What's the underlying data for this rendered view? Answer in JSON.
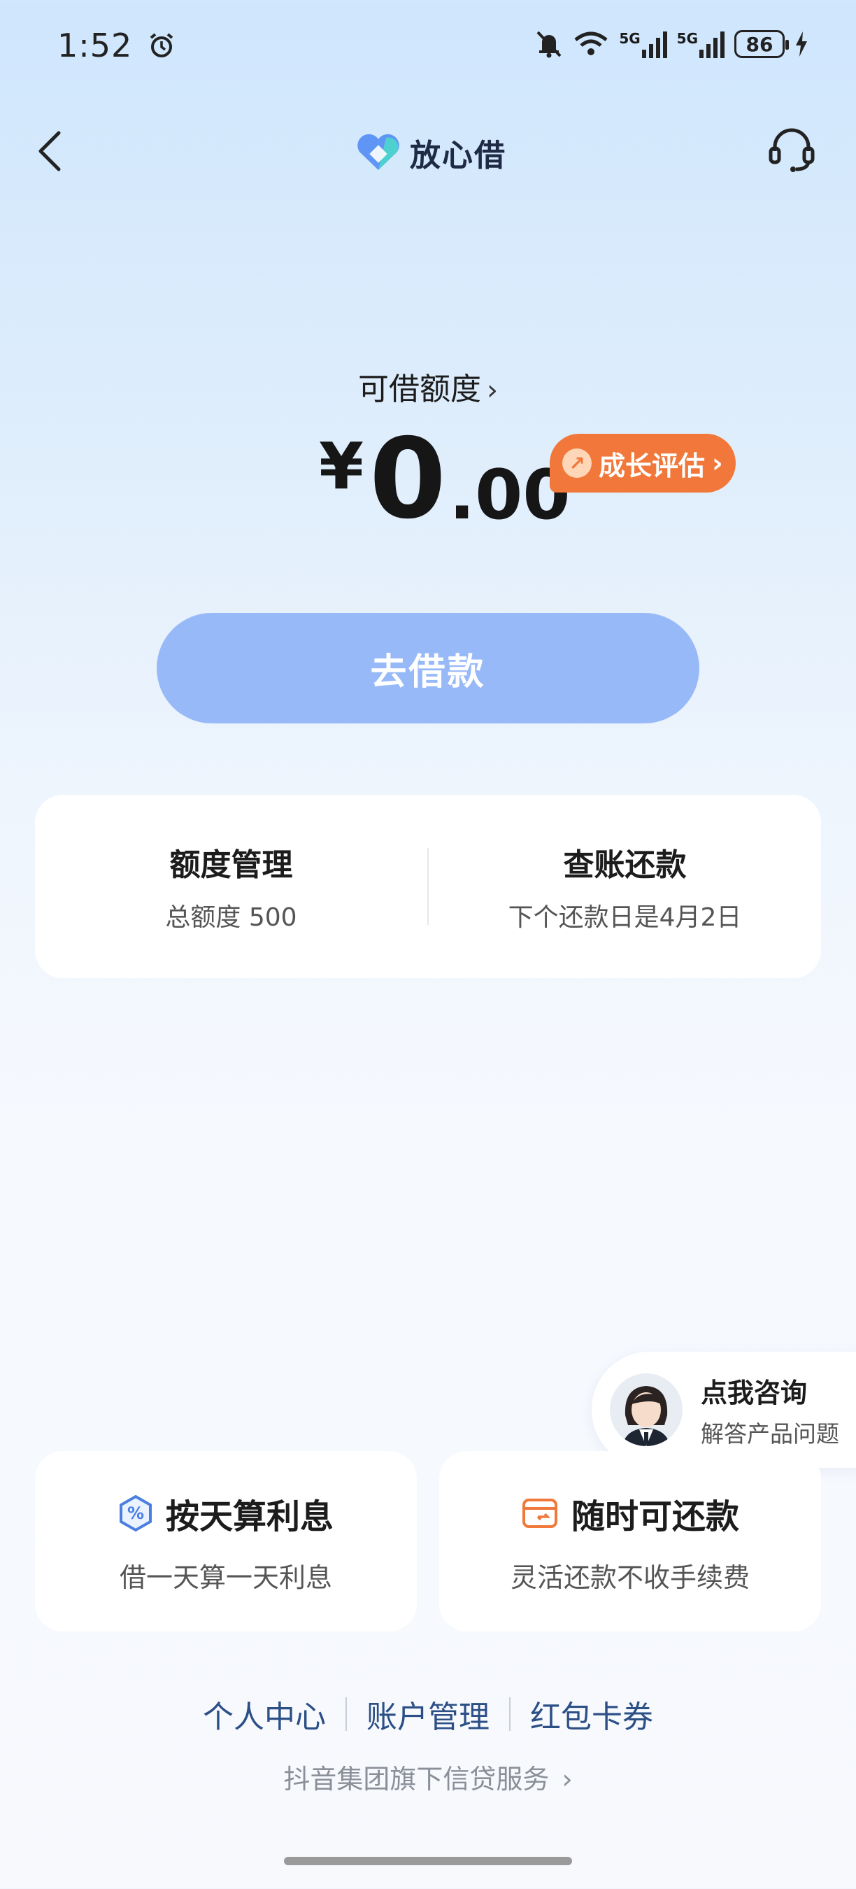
{
  "status_bar": {
    "time": "1:52",
    "signal1": "5G",
    "signal2": "5G",
    "battery": "86"
  },
  "nav": {
    "brand": "放心借"
  },
  "credit": {
    "label": "可借额度",
    "currency": "¥",
    "integer": "0",
    "decimal": ".00",
    "growth_label": "成长评估"
  },
  "borrow_button": "去借款",
  "quota_card": {
    "left": {
      "title": "额度管理",
      "sub": "总额度 500"
    },
    "right": {
      "title": "查账还款",
      "sub": "下个还款日是4月2日"
    }
  },
  "consult": {
    "title": "点我咨询",
    "sub": "解答产品问题"
  },
  "features": [
    {
      "title": "按天算利息",
      "sub": "借一天算一天利息",
      "icon": "percent-icon",
      "color": "#4a7fe0"
    },
    {
      "title": "随时可还款",
      "sub": "灵活还款不收手续费",
      "icon": "wallet-icon",
      "color": "#ef7a3c"
    }
  ],
  "footer": {
    "links": [
      "个人中心",
      "账户管理",
      "红包卡券"
    ],
    "service": "抖音集团旗下信贷服务"
  },
  "colors": {
    "accent": "#98b9f8",
    "growth": "#f1783a",
    "link": "#2c4f86"
  }
}
